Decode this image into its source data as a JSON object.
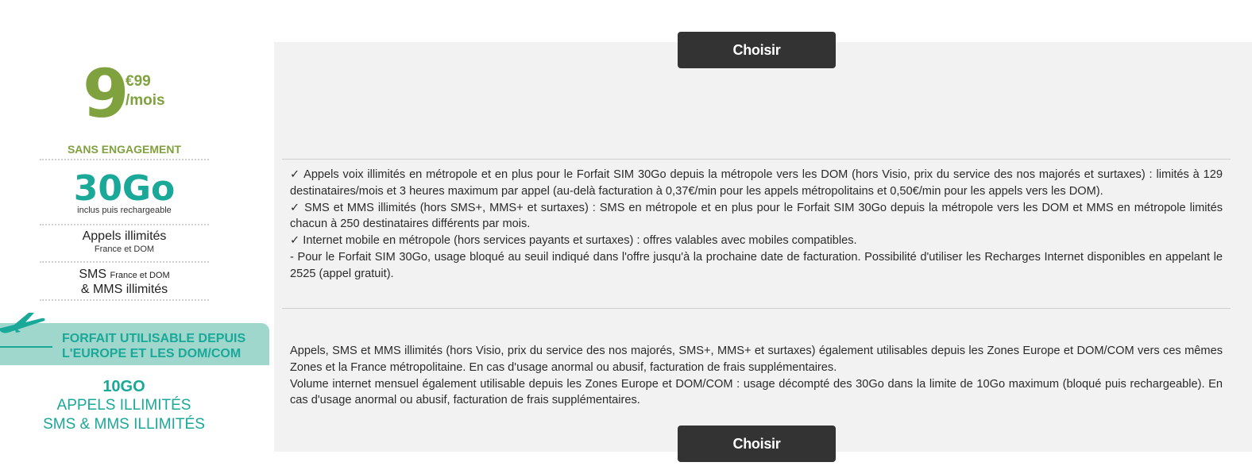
{
  "offer": {
    "price_main": "9",
    "price_cents": "€99",
    "price_period": "/mois",
    "engagement": "SANS ENGAGEMENT",
    "data_amount": "30Go",
    "data_note": "inclus puis rechargeable",
    "calls_label": "Appels illimités",
    "calls_note": "France et DOM",
    "sms_label": "SMS",
    "sms_note": "France et DOM",
    "mms_label": "& MMS illimités",
    "roaming_banner_line1": "FORFAIT UTILISABLE DEPUIS",
    "roaming_banner_line2": "L'EUROPE ET LES DOM/COM",
    "roaming_data": "10GO",
    "roaming_calls": "APPELS ILLIMITÉS",
    "roaming_sms": "SMS & MMS ILLIMITÉS"
  },
  "actions": {
    "choose_top": "Choisir",
    "choose_bottom": "Choisir"
  },
  "terms": {
    "block1": [
      "✓ Appels voix illimités en métropole et en plus pour le Forfait SIM 30Go depuis la métropole vers les DOM (hors Visio, prix du service des nos majorés et surtaxes) : limités à 129 destinataires/mois et 3 heures maximum par appel (au-delà facturation à 0,37€/min pour les appels métropolitains et 0,50€/min pour les appels vers les DOM).",
      "✓ SMS et MMS illimités (hors SMS+, MMS+ et surtaxes) : SMS en métropole et en plus pour le Forfait SIM 30Go depuis la métropole vers les DOM et MMS en métropole limités chacun à 250 destinataires différents par mois.",
      "✓ Internet mobile en métropole (hors services payants et surtaxes) : offres valables avec mobiles compatibles.",
      "- Pour le Forfait SIM 30Go, usage bloqué au seuil indiqué dans l'offre jusqu'à la prochaine date de facturation. Possibilité d'utiliser les Recharges Internet disponibles en appelant le 2525 (appel gratuit)."
    ],
    "block2": [
      "Appels, SMS et MMS illimités (hors Visio, prix du service des nos majorés, SMS+, MMS+ et surtaxes) également utilisables depuis les Zones Europe et DOM/COM vers ces mêmes Zones et la France métropolitaine. En cas d'usage anormal ou abusif, facturation de frais supplémentaires.",
      "Volume internet mensuel également utilisable depuis les Zones Europe et DOM/COM : usage décompté des 30Go dans la limite de 10Go maximum (bloqué puis rechargeable). En cas d'usage anormal ou abusif, facturation de frais supplémentaires."
    ]
  },
  "colors": {
    "green": "#7fa23e",
    "teal": "#1aa898",
    "teal_light": "#9fd7cd",
    "button": "#333333"
  }
}
